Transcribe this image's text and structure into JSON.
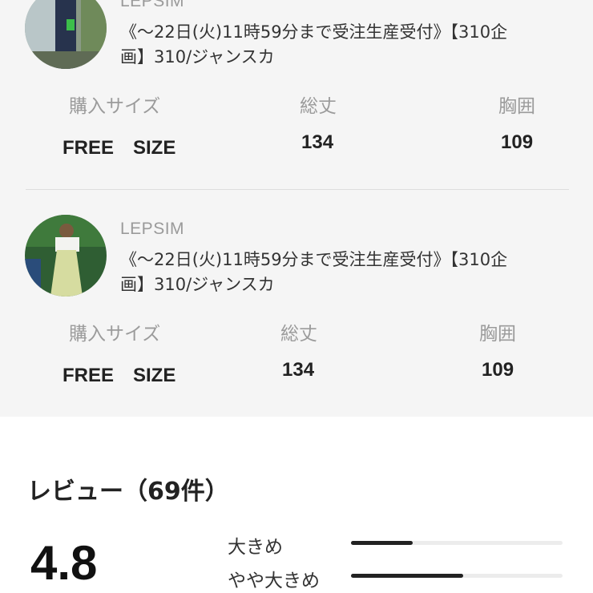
{
  "reviews": [
    {
      "brand": "LEPSIM",
      "product_line1": "《〜22日(火)11時59分まで受注生産受付》【310企",
      "product_line2": "画】310/ジャンスカ",
      "headers": {
        "size": "購入サイズ",
        "length": "総丈",
        "bust": "胸囲"
      },
      "values": {
        "size": "FREE　SIZE",
        "length": "134",
        "bust": "109"
      }
    },
    {
      "brand": "LEPSIM",
      "product_line1": "《〜22日(火)11時59分まで受注生産受付》【310企",
      "product_line2": "画】310/ジャンスカ",
      "headers": {
        "size": "購入サイズ",
        "length": "総丈",
        "bust": "胸囲"
      },
      "values": {
        "size": "FREE　SIZE",
        "length": "134",
        "bust": "109"
      }
    }
  ],
  "summary": {
    "title": "レビュー（69件）",
    "rating": "4.8",
    "fit": [
      {
        "label": "大きめ",
        "ratio": 0.29
      },
      {
        "label": "やや大きめ",
        "ratio": 0.53
      }
    ]
  }
}
